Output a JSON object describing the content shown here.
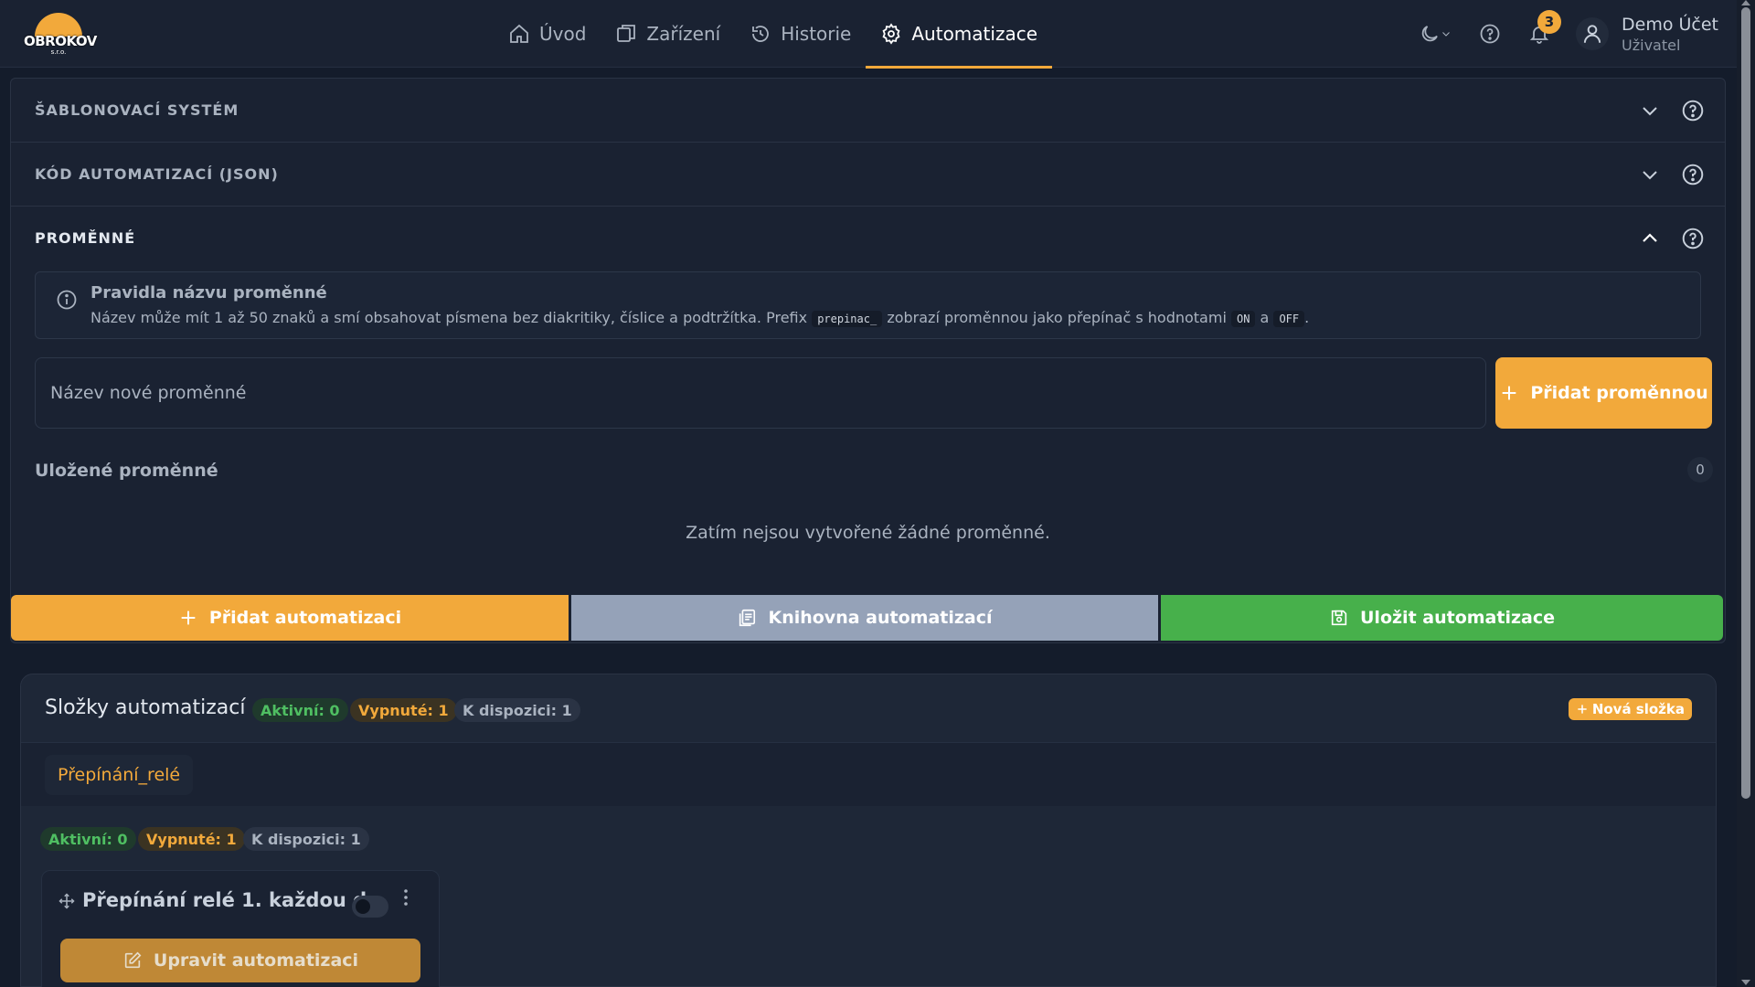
{
  "brand": {
    "logo_text": "OBROKOV",
    "logo_sub": "s.r.o."
  },
  "nav": [
    {
      "label": "Úvod",
      "icon": "home-icon",
      "active": false
    },
    {
      "label": "Zařízení",
      "icon": "devices-icon",
      "active": false
    },
    {
      "label": "Historie",
      "icon": "history-icon",
      "active": false
    },
    {
      "label": "Automatizace",
      "icon": "gear-icon",
      "active": true
    }
  ],
  "header": {
    "notifications_count": "3",
    "user_name": "Demo Účet",
    "user_role": "Uživatel"
  },
  "sections": {
    "templating": "ŠABLONOVACÍ SYSTÉM",
    "json_code": "KÓD AUTOMATIZACÍ (JSON)",
    "variables": "PROMĚNNÉ"
  },
  "variables": {
    "info_title": "Pravidla názvu proměnné",
    "info_text_1": "Název může mít 1 až 50 znaků a smí obsahovat písmena bez diakritiky, číslice a podtržítka. Prefix",
    "info_code_prefix": "prepinac_",
    "info_text_2": "zobrazí proměnnou jako přepínač s hodnotami",
    "info_code_on": "ON",
    "info_text_3": "a",
    "info_code_off": "OFF",
    "info_text_4": ".",
    "input_placeholder": "Název nové proměnné",
    "add_button": "Přidat proměnnou",
    "saved_label": "Uložené proměnné",
    "saved_count": "0",
    "empty_message": "Zatím nejsou vytvořené žádné proměnné."
  },
  "actions": {
    "add_automation": "Přidat automatizaci",
    "library": "Knihovna automatizací",
    "save": "Uložit automatizace"
  },
  "folders": {
    "title": "Složky automatizací",
    "active": "Aktivní: 0",
    "disabled": "Vypnuté: 1",
    "available": "K dispozici: 1",
    "new_folder": "Nová složka",
    "tab": "Přepínání_relé",
    "tab_active": "Aktivní: 0",
    "tab_disabled": "Vypnuté: 1",
    "tab_available": "K dispozici: 1",
    "automation_title": "Přepínání relé 1. každou d...",
    "automation_enabled": false,
    "edit_button": "Upravit automatizaci"
  },
  "colors": {
    "accent": "#f2a93b",
    "success": "#47b04b",
    "neutral_button": "#95a2b8",
    "background": "#141c2b"
  }
}
